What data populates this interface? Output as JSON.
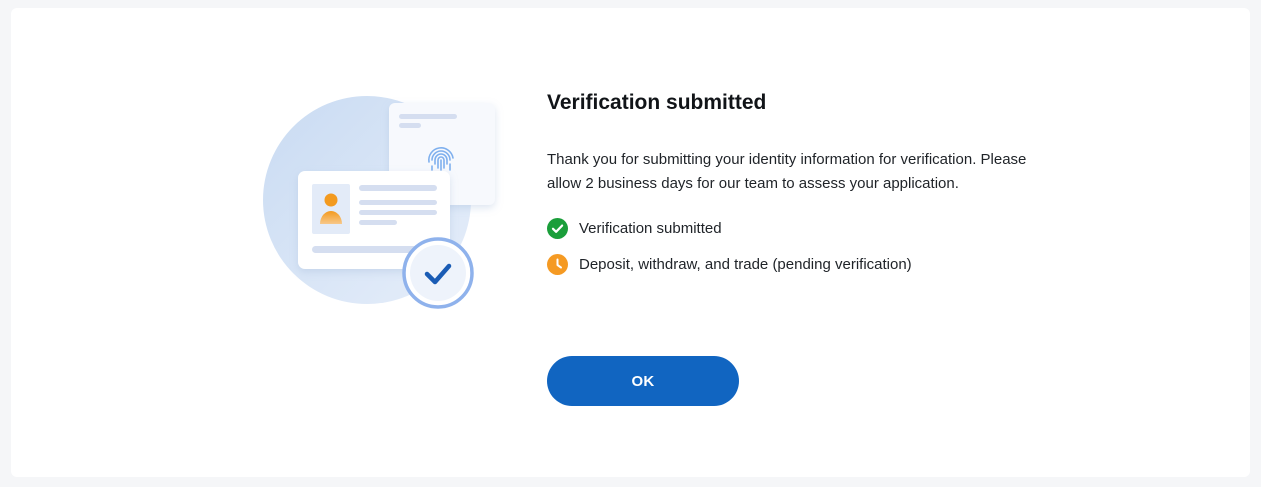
{
  "dialog": {
    "title": "Verification submitted",
    "description": "Thank you for submitting your identity information for verification. Please allow 2 business days for our team to assess your application.",
    "statuses": [
      {
        "label": "Verification submitted",
        "icon": "check-circle-icon",
        "color": "#1a9e3a"
      },
      {
        "label": "Deposit, withdraw, and trade (pending verification)",
        "icon": "clock-icon",
        "color": "#f59a23"
      }
    ],
    "ok_label": "OK"
  },
  "colors": {
    "accent": "#1165c1",
    "success": "#1a9e3a",
    "pending": "#f59a23"
  }
}
